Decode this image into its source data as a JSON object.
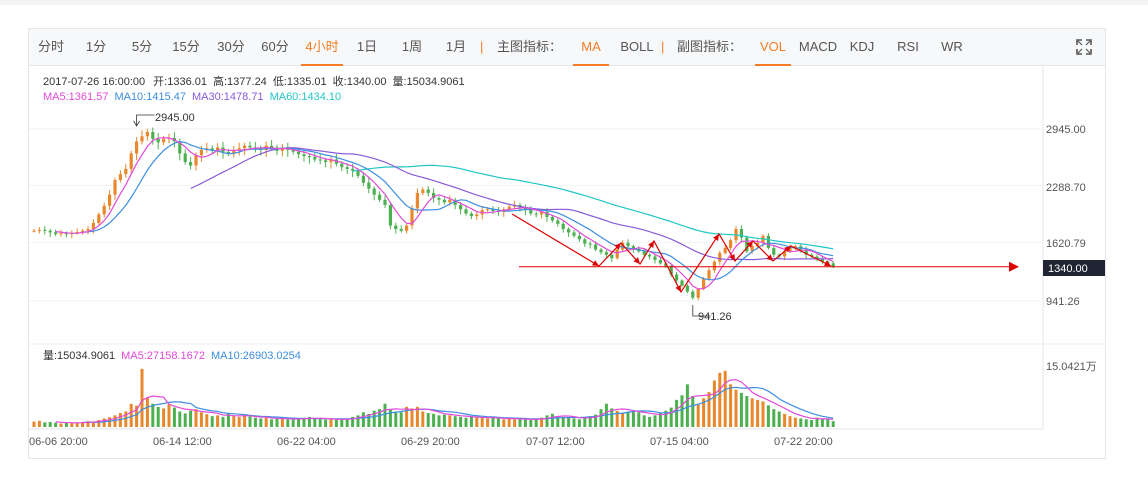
{
  "toolbar": {
    "periods": [
      "分时",
      "1分",
      "5分",
      "15分",
      "30分",
      "60分",
      "4小时",
      "1日",
      "1周",
      "1月"
    ],
    "active_period": "4小时",
    "main_indicator_label": "主图指标：",
    "main_indicators": [
      "MA",
      "BOLL"
    ],
    "active_main": "MA",
    "sub_indicator_label": "副图指标：",
    "sub_indicators": [
      "VOL",
      "MACD",
      "KDJ",
      "RSI",
      "WR"
    ],
    "active_sub": "VOL",
    "separator": "|",
    "fullscreen_icon": "fullscreen-icon"
  },
  "colors": {
    "accent": "#f47d26",
    "up": "#e8872b",
    "down": "#4cb050",
    "ma5": "#e24ad8",
    "ma10": "#3c8ee0",
    "ma30": "#8a5ad8",
    "ma60": "#22c6c6",
    "annotation": "#dd0000"
  },
  "chart_data": {
    "type": "candlestick",
    "info": {
      "datetime": "2017-07-26 16:00:00",
      "open_label": "开:1336.01",
      "high_label": "高:1377.24",
      "low_label": "低:1335.01",
      "close_label": "收:1340.00",
      "vol_label": "量:15034.9061"
    },
    "ma_legend": [
      {
        "name": "MA5",
        "text": "MA5:1361.57",
        "color": "#e24ad8"
      },
      {
        "name": "MA10",
        "text": "MA10:1415.47",
        "color": "#3c8ee0"
      },
      {
        "name": "MA30",
        "text": "MA30:1478.71",
        "color": "#8a5ad8"
      },
      {
        "name": "MA60",
        "text": "MA60:1434.10",
        "color": "#22c6c6"
      }
    ],
    "y_ticks": [
      "2945.00",
      "2288.70",
      "1620.79",
      "941.26"
    ],
    "y_tick_values": [
      2945.0,
      2288.7,
      1620.79,
      941.26
    ],
    "last_price": "1340.00",
    "last_price_value": 1340.0,
    "max_marker": {
      "label": "2945.00",
      "value": 2945.0,
      "x_index": 19
    },
    "min_marker": {
      "label": "941.26",
      "value": 941.26,
      "x_index": 122
    },
    "x_ticks": [
      "06-06 20:00",
      "06-14 12:00",
      "06-22 04:00",
      "06-29 20:00",
      "07-07 12:00",
      "07-15 04:00",
      "07-22 20:00"
    ],
    "x_tick_index": [
      0,
      23,
      46,
      69,
      92,
      115,
      138
    ],
    "price_ylim": [
      700,
      3400
    ],
    "close": [
      1760,
      1770,
      1760,
      1740,
      1720,
      1730,
      1725,
      1735,
      1745,
      1760,
      1780,
      1850,
      1950,
      2050,
      2180,
      2350,
      2420,
      2480,
      2660,
      2800,
      2860,
      2910,
      2830,
      2790,
      2830,
      2840,
      2800,
      2660,
      2560,
      2520,
      2640,
      2700,
      2720,
      2700,
      2730,
      2680,
      2660,
      2700,
      2720,
      2750,
      2730,
      2720,
      2700,
      2750,
      2730,
      2690,
      2720,
      2700,
      2680,
      2650,
      2630,
      2620,
      2590,
      2580,
      2560,
      2590,
      2540,
      2500,
      2480,
      2460,
      2400,
      2320,
      2250,
      2180,
      2120,
      2060,
      1820,
      1780,
      1760,
      1820,
      2020,
      2200,
      2240,
      2200,
      2140,
      2120,
      2090,
      2120,
      2060,
      2010,
      1960,
      1930,
      1950,
      2000,
      2010,
      1990,
      1980,
      2010,
      2040,
      2060,
      2030,
      2000,
      1960,
      1950,
      1980,
      1920,
      1880,
      1840,
      1780,
      1740,
      1700,
      1660,
      1610,
      1600,
      1540,
      1510,
      1480,
      1440,
      1540,
      1620,
      1580,
      1550,
      1520,
      1480,
      1460,
      1420,
      1380,
      1350,
      1250,
      1180,
      1120,
      1050,
      980,
      1080,
      1200,
      1300,
      1400,
      1500,
      1560,
      1650,
      1780,
      1680,
      1520,
      1580,
      1620,
      1700,
      1560,
      1480,
      1460,
      1520,
      1560,
      1580,
      1540,
      1480,
      1460,
      1430,
      1400,
      1380,
      1340
    ],
    "volume_ylim": [
      0,
      160000
    ],
    "volume_tick": "15.0421万",
    "volume": [
      14000,
      16000,
      12000,
      13000,
      11000,
      9000,
      12000,
      10000,
      11000,
      13000,
      15000,
      14000,
      18000,
      22000,
      25000,
      30000,
      36000,
      40000,
      60000,
      55000,
      150000,
      75000,
      60000,
      52000,
      48000,
      58000,
      50000,
      40000,
      35000,
      42000,
      46000,
      38000,
      33000,
      28000,
      30000,
      26000,
      34000,
      28000,
      26000,
      30000,
      27000,
      24000,
      22000,
      24000,
      20000,
      22000,
      21000,
      20000,
      19000,
      22000,
      24000,
      26000,
      21000,
      20000,
      19000,
      20000,
      18000,
      22000,
      20000,
      26000,
      30000,
      38000,
      34000,
      42000,
      46000,
      60000,
      45000,
      40000,
      38000,
      52000,
      48000,
      52000,
      40000,
      36000,
      34000,
      30000,
      32000,
      30000,
      28000,
      26000,
      24000,
      26000,
      25000,
      24000,
      22000,
      24000,
      22000,
      20000,
      22000,
      20000,
      21000,
      19000,
      18000,
      20000,
      24000,
      30000,
      34000,
      28000,
      26000,
      24000,
      22000,
      20000,
      26000,
      28000,
      32000,
      46000,
      60000,
      48000,
      42000,
      36000,
      40000,
      44000,
      38000,
      30000,
      26000,
      30000,
      36000,
      42000,
      50000,
      70000,
      82000,
      110000,
      80000,
      60000,
      74000,
      90000,
      120000,
      140000,
      145000,
      110000,
      96000,
      88000,
      80000,
      74000,
      70000,
      66000,
      56000,
      46000,
      40000,
      34000,
      28000,
      24000,
      22000,
      20000,
      18000,
      24000,
      20000,
      22000,
      15034
    ]
  },
  "volume_legend": [
    {
      "text": "量:15034.9061",
      "color": "#333333"
    },
    {
      "text": "MA5:27158.1672",
      "color": "#e24ad8"
    },
    {
      "text": "MA10:26903.0254",
      "color": "#3c8ee0"
    }
  ]
}
